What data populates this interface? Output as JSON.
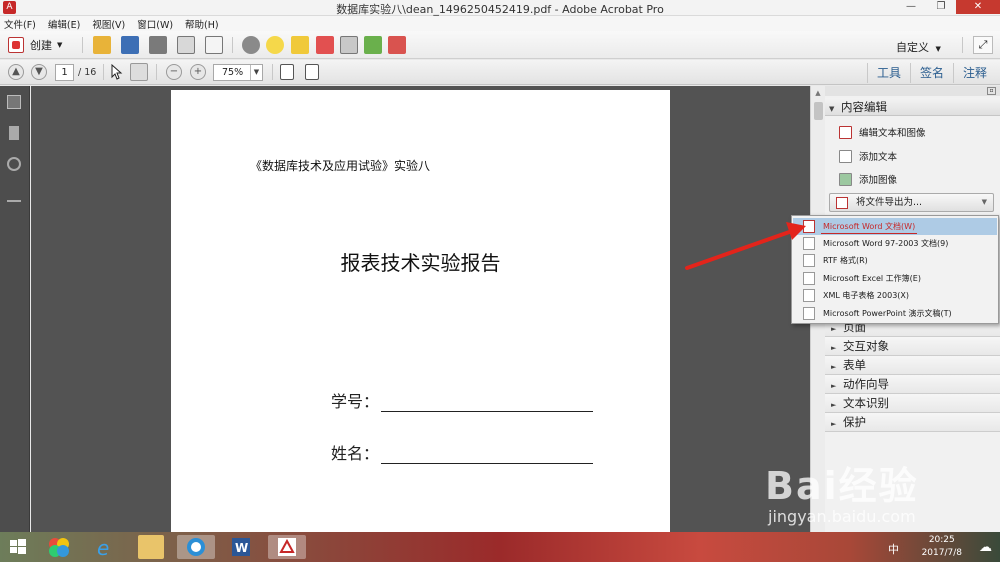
{
  "window": {
    "title": "数据库实验八\\dean_1496250452419.pdf - Adobe Acrobat Pro",
    "minimize": "—",
    "restore": "❐",
    "close": "✕"
  },
  "menu": [
    "文件(F)",
    "编辑(E)",
    "视图(V)",
    "窗口(W)",
    "帮助(H)"
  ],
  "toolbar": {
    "create_label": "创建",
    "customize_label": "自定义",
    "page_current": "1",
    "page_total": "/ 16",
    "zoom": "75%"
  },
  "tabs": [
    "工具",
    "签名",
    "注释"
  ],
  "document": {
    "subtitle": "《数据库技术及应用试验》实验八",
    "title": "报表技术实验报告",
    "field_id": "学号：",
    "field_name": "姓名："
  },
  "panel": {
    "content_edit_header": "内容编辑",
    "edit_text_image": "编辑文本和图像",
    "add_text": "添加文本",
    "add_image": "添加图像",
    "export_label": "将文件导出为...",
    "sections": [
      "页面",
      "交互对象",
      "表单",
      "动作向导",
      "文本识别",
      "保护"
    ]
  },
  "export_menu": [
    "Microsoft Word 文档(W)",
    "Microsoft Word 97-2003 文档(9)",
    "RTF 格式(R)",
    "Microsoft Excel 工作簿(E)",
    "XML 电子表格 2003(X)",
    "Microsoft PowerPoint 演示文稿(T)"
  ],
  "taskbar": {
    "time": "20:25",
    "date": "2017/7/8",
    "ime": "中"
  },
  "watermark": {
    "logo": "Bai经验",
    "url": "jingyan.baidu.com"
  },
  "colors": {
    "accent_red": "#c62828",
    "selection_blue": "#aecbe5",
    "doc_background": "#535353"
  }
}
